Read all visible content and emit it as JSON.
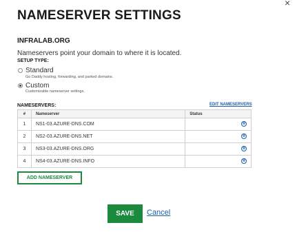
{
  "dialog": {
    "close_glyph": "×",
    "title": "NAMESERVER SETTINGS",
    "domain": "INFRALAB.ORG",
    "description": "Nameservers point your domain to where it is located."
  },
  "setup": {
    "label": "SETUP TYPE:",
    "selected": "Custom",
    "options": [
      {
        "label": "Standard",
        "sublabel": "Go Daddy hosting, forwarding, and parked domains.",
        "checked": false
      },
      {
        "label": "Custom",
        "sublabel": "Customizable nameserver settings.",
        "checked": true
      }
    ]
  },
  "nameservers": {
    "label": "NAMESERVERS:",
    "edit_link": "EDIT NAMESERVERS",
    "columns": [
      "#",
      "Nameserver",
      "Status"
    ],
    "rows": [
      {
        "num": "1",
        "name": "NS1-03.AZURE-DNS.COM",
        "status": ""
      },
      {
        "num": "2",
        "name": "NS2-03.AZURE-DNS.NET",
        "status": ""
      },
      {
        "num": "3",
        "name": "NS3-03.AZURE-DNS.ORG",
        "status": ""
      },
      {
        "num": "4",
        "name": "NS4-03.AZURE-DNS.INFO",
        "status": ""
      }
    ],
    "remove_icon": "remove-circle-icon",
    "remove_glyph": "⊗"
  },
  "actions": {
    "add_label": "ADD NAMESERVER",
    "save_label": "SAVE",
    "cancel_label": "Cancel"
  },
  "colors": {
    "accent_green": "#1b8a3c",
    "link_blue": "#1a5ea8"
  }
}
